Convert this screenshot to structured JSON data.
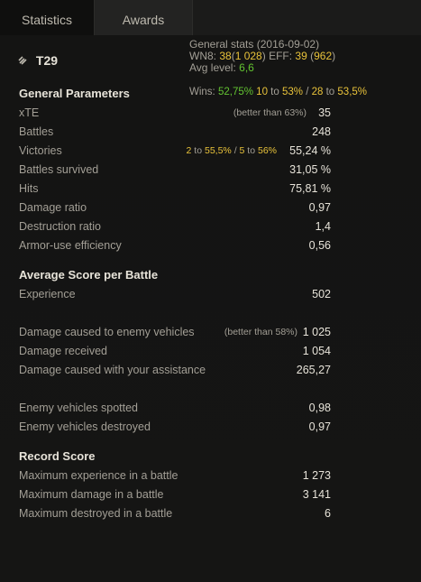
{
  "tabs": {
    "statistics": "Statistics",
    "awards": "Awards"
  },
  "header": {
    "general_stats_label": "General stats",
    "general_stats_date": "(2016-09-02)",
    "wn8_label": "WN8:",
    "wn8_value": "38",
    "wn8_paren_open": "(",
    "wn8_secondary": "1 028",
    "wn8_paren_close": ")",
    "eff_label": "EFF:",
    "eff_value": "39",
    "eff_secondary": "962",
    "avg_level_label": "Avg level:",
    "avg_level_value": "6,6"
  },
  "tank_name": "T29",
  "general": {
    "title": "General Parameters",
    "wins_label": "Wins:",
    "wins_value": "52,75%",
    "wins_target1_count": "10",
    "wins_to1": "to",
    "wins_target1_pct": "53%",
    "wins_sep": "/",
    "wins_target2_count": "28",
    "wins_to2": "to",
    "wins_target2_pct": "53,5%",
    "xte_label": "xTE",
    "xte_note": "(better than 63%)",
    "xte_value": "35",
    "battles_label": "Battles",
    "battles_value": "248",
    "victories_label": "Victories",
    "vic_count1": "2",
    "vic_to1": "to",
    "vic_pct1": "55,5%",
    "vic_sep": "/",
    "vic_count2": "5",
    "vic_to2": "to",
    "vic_pct2": "56%",
    "victories_value": "55,24 %",
    "survived_label": "Battles survived",
    "survived_value": "31,05 %",
    "hits_label": "Hits",
    "hits_value": "75,81 %",
    "dmg_ratio_label": "Damage ratio",
    "dmg_ratio_value": "0,97",
    "destr_ratio_label": "Destruction ratio",
    "destr_ratio_value": "1,4",
    "armor_label": "Armor-use efficiency",
    "armor_value": "0,56"
  },
  "average": {
    "title": "Average Score per Battle",
    "exp_label": "Experience",
    "exp_value": "502",
    "dmg_caused_label": "Damage caused to enemy vehicles",
    "dmg_caused_note": "(better than 58%)",
    "dmg_caused_value": "1 025",
    "dmg_received_label": "Damage received",
    "dmg_received_value": "1 054",
    "assist_label": "Damage caused with your assistance",
    "assist_value": "265,27",
    "spotted_label": "Enemy vehicles spotted",
    "spotted_value": "0,98",
    "destroyed_label": "Enemy vehicles destroyed",
    "destroyed_value": "0,97"
  },
  "record": {
    "title": "Record Score",
    "max_exp_label": "Maximum experience in a battle",
    "max_exp_value": "1 273",
    "max_dmg_label": "Maximum damage in a battle",
    "max_dmg_value": "3 141",
    "max_destr_label": "Maximum destroyed in a battle",
    "max_destr_value": "6"
  },
  "colors": {
    "yellow": "#e8c23a",
    "green": "#62c331",
    "orange": "#f0823a",
    "background": "#1b1b1a"
  }
}
